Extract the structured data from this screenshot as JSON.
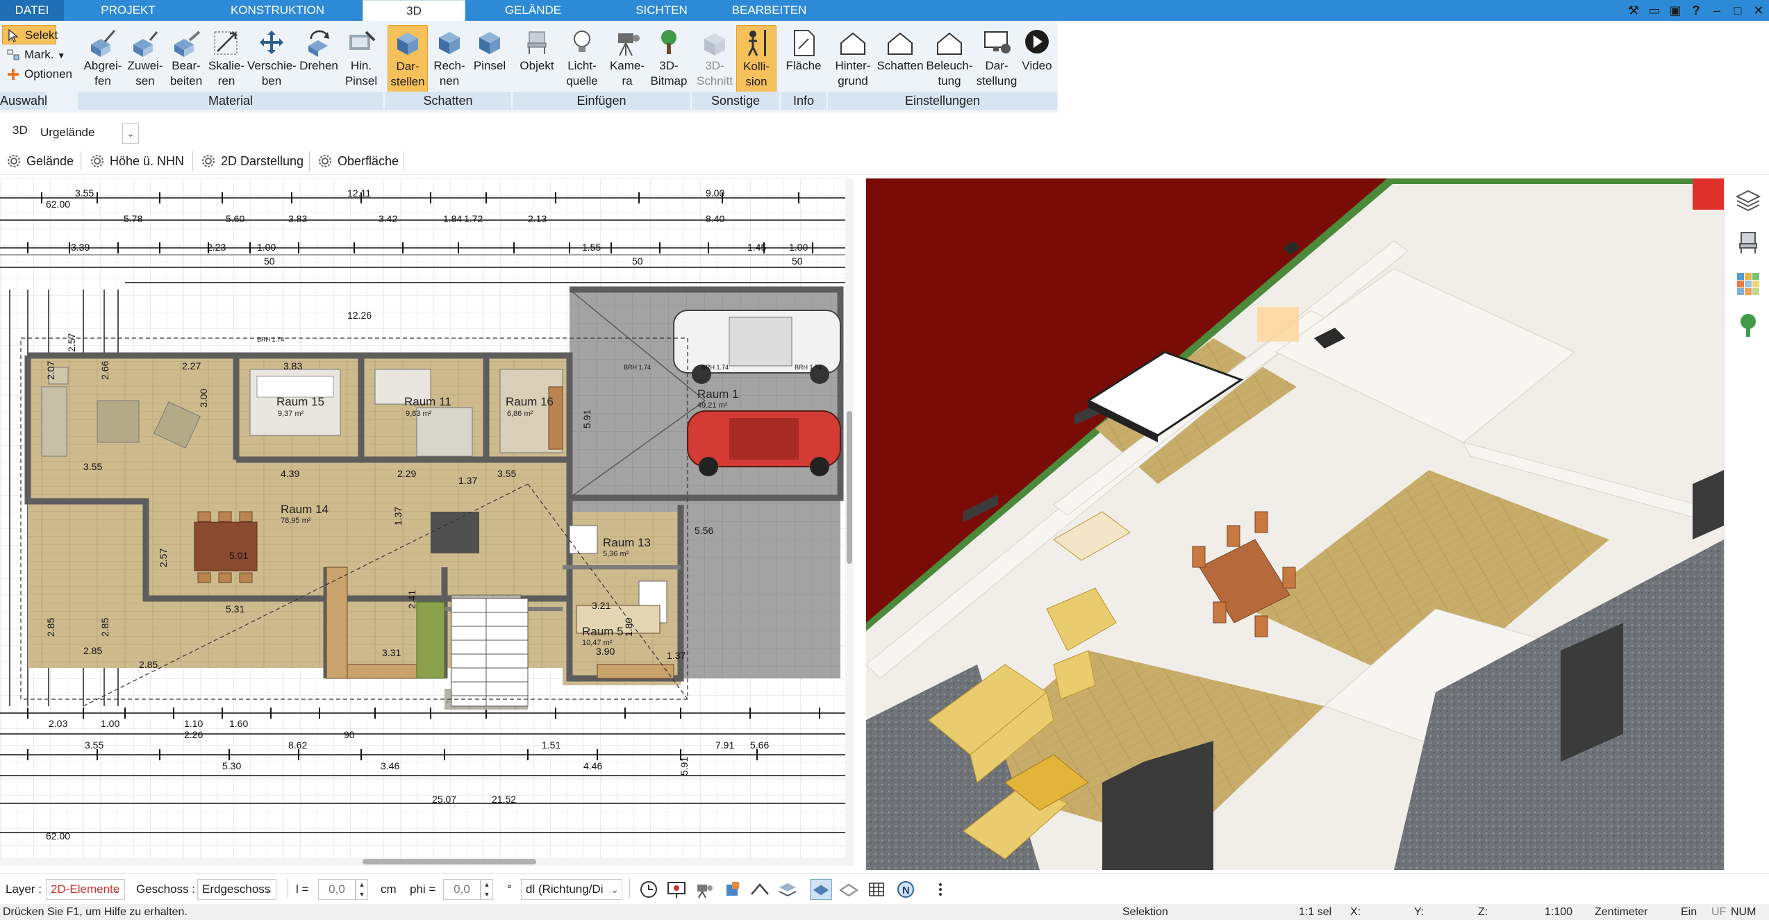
{
  "menu": {
    "tabs": [
      "DATEI",
      "PROJEKT",
      "KONSTRUKTION",
      "3D",
      "GELÄNDE",
      "SICHTEN",
      "BEARBEITEN"
    ],
    "active": "3D"
  },
  "ribbon": {
    "auswahl": {
      "selekt": "Selekt",
      "mark": "Mark.",
      "optionen": "Optionen",
      "group": "Auswahl"
    },
    "material": {
      "group": "Material",
      "buttons": [
        "Abgrei-\nfen",
        "Zuwei-\nsen",
        "Bear-\nbeiten",
        "Skalie-\nren",
        "Verschie-\nben",
        "Drehen",
        "Hin.\nPinsel"
      ]
    },
    "schatten": {
      "group": "Schatten",
      "buttons": [
        "Dar-\nstellen",
        "Rech-\nnen",
        "Pinsel"
      ]
    },
    "einfuegen": {
      "group": "Einfügen",
      "buttons": [
        "Objekt",
        "Licht-\nquelle",
        "Kame-\nra",
        "3D-\nBitmap"
      ]
    },
    "sonstige": {
      "group": "Sonstige",
      "buttons": [
        "3D-\nSchnitt",
        "Kolli-\nsion"
      ]
    },
    "info": {
      "group": "Info",
      "buttons": [
        "Fläche"
      ]
    },
    "einstellungen": {
      "group": "Einstellungen",
      "buttons": [
        "Hinter-\ngrund",
        "Schatten",
        "Beleuch-\ntung",
        "Dar-\nstellung",
        "Video"
      ]
    }
  },
  "toolbar": {
    "mode": "3D",
    "terrain_select": "Urgelände",
    "buttons": [
      "Gelände",
      "Höhe ü. NHN",
      "2D Darstellung",
      "Oberfläche"
    ]
  },
  "plan": {
    "rooms": [
      {
        "name": "Raum 15",
        "area": "9,37 m²"
      },
      {
        "name": "Raum 11",
        "area": "9,83 m²"
      },
      {
        "name": "Raum 16",
        "area": "6,86 m²"
      },
      {
        "name": "Raum 1",
        "area": "49,21 m²"
      },
      {
        "name": "Raum 14",
        "area": "78,95 m²"
      },
      {
        "name": "Raum 13",
        "area": "5,36 m²"
      },
      {
        "name": "Raum 5",
        "area": "10,47 m²"
      }
    ],
    "dims_top": [
      "62.00",
      "3.55",
      "12.11",
      "9.00",
      "5.78",
      "5.60",
      "3.83",
      "3.42",
      "1.84",
      "1.72",
      "2.13",
      "8.40",
      "3.39",
      "2.23",
      "1.00",
      "1.55",
      "1.45",
      "1.00",
      "50"
    ],
    "dims_bottom": [
      "2.03",
      "1.00",
      "1.10",
      "1.60",
      "2.26",
      "90",
      "3.55",
      "8.62",
      "1.51",
      "7.91",
      "5.66",
      "5.30",
      "3.46",
      "4.46",
      "25.07",
      "21.52",
      "62.00"
    ],
    "inner_dims": [
      "12.26",
      "2.27",
      "3.83",
      "4.39",
      "2.29",
      "3.55",
      "5.91",
      "5.56",
      "5.31",
      "5.01",
      "3.31",
      "3.21",
      "3.90",
      "2.41",
      "2.57",
      "2.85",
      "1.80",
      "2.66",
      "3.00",
      "2.07",
      "1.37"
    ],
    "brh": "BRH 1.74"
  },
  "propbar": {
    "layer_label": "Layer :",
    "layer_value": "2D-Elemente",
    "geschoss_label": "Geschoss :",
    "geschoss_value": "Erdgeschoss",
    "l_label": "l =",
    "l_value": "0,0",
    "l_unit": "cm",
    "phi_label": "phi =",
    "phi_value": "0,0",
    "phi_unit": "°",
    "dl_value": "dl (Richtung/Di"
  },
  "status": {
    "help": "Drücken Sie F1, um Hilfe zu erhalten.",
    "mode": "Selektion",
    "sel": "1:1 sel",
    "x": "X:",
    "y": "Y:",
    "z": "Z:",
    "scale": "1:100",
    "unit": "Zentimeter",
    "ein": "Ein",
    "uf": "UF",
    "num": "NUM"
  },
  "colors": {
    "accent": "#2d8ad6",
    "ribbon_bg": "#eef3f9",
    "group_bg": "#d7e5f3",
    "active_btn": "#f6c15a",
    "red_sky": "#7a0c08",
    "wall": "#efece7",
    "floor": "#c8ad6a",
    "garage": "#9a9aa0"
  }
}
